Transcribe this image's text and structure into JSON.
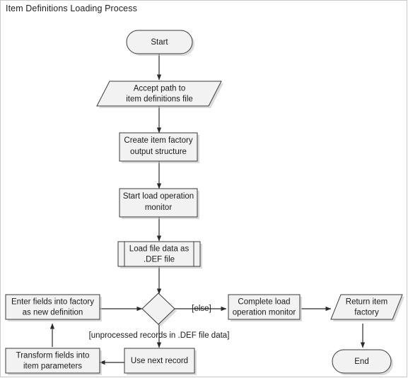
{
  "title": "Item Definitions Loading Process",
  "colors": {
    "node_fill": "#f2f2f2",
    "node_stroke": "#3a3a3a",
    "edge_stroke": "#2b2b2b",
    "shadow": "#bdbdbd",
    "frame_border": "#c9c9c9",
    "text": "#1a1a1a",
    "background": "#ffffff"
  },
  "nodes": {
    "start": {
      "label": "Start",
      "shape": "terminator"
    },
    "accept_path": {
      "line1": "Accept path to",
      "line2": "item definitions file",
      "shape": "input-parallelogram"
    },
    "create_factory": {
      "line1": "Create item factory",
      "line2": "output structure",
      "shape": "process"
    },
    "start_monitor": {
      "line1": "Start load operation",
      "line2": "monitor",
      "shape": "process"
    },
    "load_file": {
      "line1": "Load file data as",
      "line2": ".DEF file",
      "shape": "predefined-process"
    },
    "decision": {
      "label": "",
      "shape": "decision"
    },
    "enter_fields": {
      "line1": "Enter fields into factory",
      "line2": "as new definition",
      "shape": "process"
    },
    "complete_monitor": {
      "line1": "Complete load",
      "line2": "operation monitor",
      "shape": "process"
    },
    "return_factory": {
      "line1": "Return item",
      "line2": "factory",
      "shape": "output-parallelogram"
    },
    "transform_fields": {
      "line1": "Transform fields into",
      "line2": "item parameters",
      "shape": "process"
    },
    "use_next_record": {
      "line1": "Use next record",
      "line2": "",
      "shape": "process"
    },
    "end": {
      "label": "End",
      "shape": "terminator"
    }
  },
  "guards": {
    "else_branch": "[else]",
    "loop_branch": "[unprocessed records in .DEF file data]"
  },
  "edges": [
    {
      "from": "start",
      "to": "accept_path"
    },
    {
      "from": "accept_path",
      "to": "create_factory"
    },
    {
      "from": "create_factory",
      "to": "start_monitor"
    },
    {
      "from": "start_monitor",
      "to": "load_file"
    },
    {
      "from": "load_file",
      "to": "decision"
    },
    {
      "from": "decision",
      "to": "complete_monitor",
      "label": "[else]"
    },
    {
      "from": "decision",
      "to": "use_next_record",
      "label": "[unprocessed records in .DEF file data]"
    },
    {
      "from": "use_next_record",
      "to": "transform_fields"
    },
    {
      "from": "transform_fields",
      "to": "enter_fields"
    },
    {
      "from": "enter_fields",
      "to": "decision"
    },
    {
      "from": "complete_monitor",
      "to": "return_factory"
    },
    {
      "from": "return_factory",
      "to": "end"
    }
  ]
}
